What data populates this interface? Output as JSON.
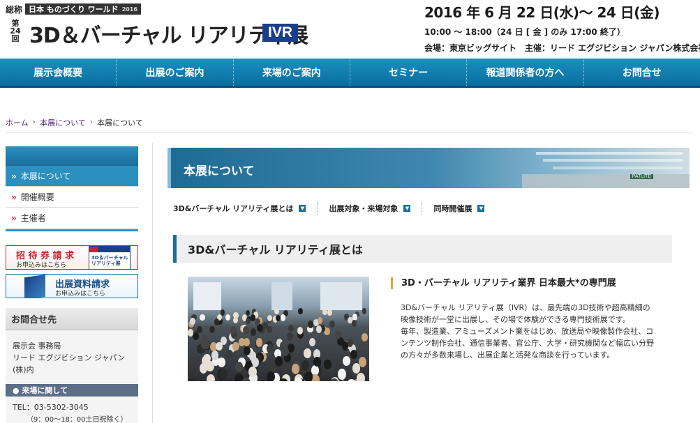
{
  "header": {
    "sokan": "総称",
    "monozukuri": "日本 ものづくり ワールド",
    "monozukuri_year": "2016",
    "edition": "第24回",
    "show_name": "3D＆バーチャル リアリティ展",
    "show_abbr": "IVR",
    "date": "2016 年 6 月 22 日(水)～ 24 日(金)",
    "hours": "10:00 ～ 18:00（24 日 [ 金 ] のみ 17:00 終了）",
    "venue": "会場：東京ビッグサイト　主催：リード エグジビション ジャパン株式会社"
  },
  "gnav": [
    {
      "label": "展示会概要"
    },
    {
      "label": "出展のご案内"
    },
    {
      "label": "来場のご案内"
    },
    {
      "label": "セミナー"
    },
    {
      "label": "報道関係者の方へ"
    },
    {
      "label": "お問合せ"
    }
  ],
  "breadcrumb": {
    "home": "ホーム",
    "parent": "本展について",
    "current": "本展について"
  },
  "sidebar": {
    "items": [
      {
        "label": "本展について",
        "marker": "»"
      },
      {
        "label": "開催概要",
        "marker": "»"
      },
      {
        "label": "主催者",
        "marker": "»"
      }
    ],
    "banner_invite": {
      "title": "招 待 券 請 求",
      "sub": "お申込みはこちら",
      "thumb_text": "3D＆バーチャル リアリティ展"
    },
    "banner_exhibit": {
      "title": "出展資料請求",
      "sub": "お申込みはこちら"
    },
    "contact": {
      "heading": "お問合せ先",
      "office": "展示会 事務局",
      "company": "リード エグジビション ジャパン(株)内",
      "visitor_heading": "● 来場に関して",
      "tel": "TEL：03-5302-3045",
      "hours": "（9：00～18：00土日祝除く）"
    }
  },
  "main": {
    "page_title": "本展について",
    "hall_sign": "PATLITE",
    "anchors": [
      {
        "label": "3D&バーチャル リアリティ展とは"
      },
      {
        "label": "出展対象・来場対象"
      },
      {
        "label": "同時開催展"
      }
    ],
    "section_title": "3D&バーチャル リアリティ展とは",
    "feature_title": "3D・バーチャル リアリティ業界 日本最大*の専門展",
    "feature_text": "3D&バーチャル リアリティ展（IVR）は、最先端の3D技術や超高精細の映像技術が一堂に出展し、その場で体験ができる専門技術展です。\n毎年、製造業、アミューズメント業をはじめ、放送局や映像製作会社、コンテンツ制作会社、通信事業者、官公庁、大学・研究機関など幅広い分野の方々が多数来場し、出展企業と活発な商談を行っています。"
  },
  "colors": {
    "nav_blue": "#0a6ea0",
    "accent_red": "#c0282d",
    "ivr_navy": "#1a3f8a",
    "feature_accent": "#e8a037"
  }
}
